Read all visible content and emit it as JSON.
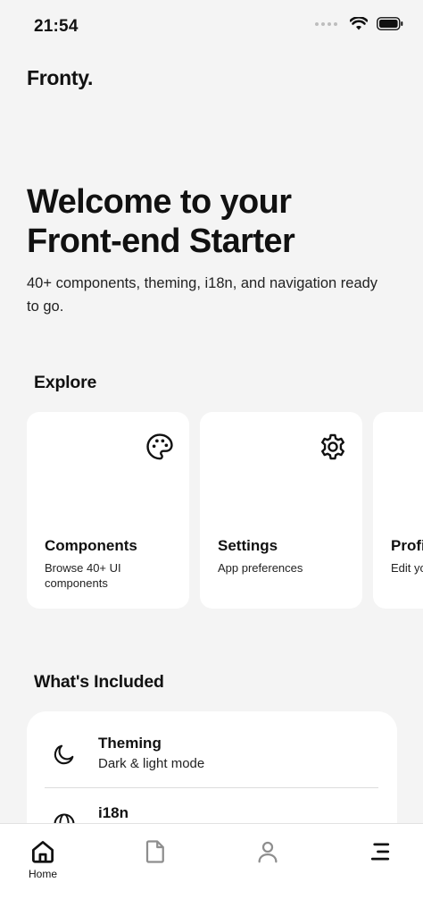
{
  "status_bar": {
    "time": "21:54"
  },
  "brand": "Fronty.",
  "hero": {
    "title_line1": "Welcome to your",
    "title_line2": "Front-end Starter",
    "subtitle": "40+ components, theming, i18n, and navigation ready to go."
  },
  "explore": {
    "title": "Explore",
    "cards": [
      {
        "title": "Components",
        "description": "Browse 40+ UI components",
        "icon": "palette-icon"
      },
      {
        "title": "Settings",
        "description": "App preferences",
        "icon": "gear-icon"
      },
      {
        "title": "Profile",
        "description": "Edit your profile",
        "icon": "person-icon"
      }
    ]
  },
  "included": {
    "title": "What's Included",
    "items": [
      {
        "title": "Theming",
        "description": "Dark & light mode",
        "icon": "moon-icon"
      },
      {
        "title": "i18n",
        "description": "",
        "icon": "globe-icon"
      }
    ]
  },
  "tab_bar": {
    "tabs": [
      {
        "label": "Home",
        "icon": "home-icon",
        "active": true
      },
      {
        "label": "",
        "icon": "document-icon",
        "active": false
      },
      {
        "label": "",
        "icon": "person-icon",
        "active": false
      },
      {
        "label": "",
        "icon": "menu-icon",
        "active": false
      }
    ]
  },
  "colors": {
    "background": "#f4f4f4",
    "card": "#ffffff",
    "text": "#111111",
    "inactive_icon": "#8e8e8e"
  }
}
